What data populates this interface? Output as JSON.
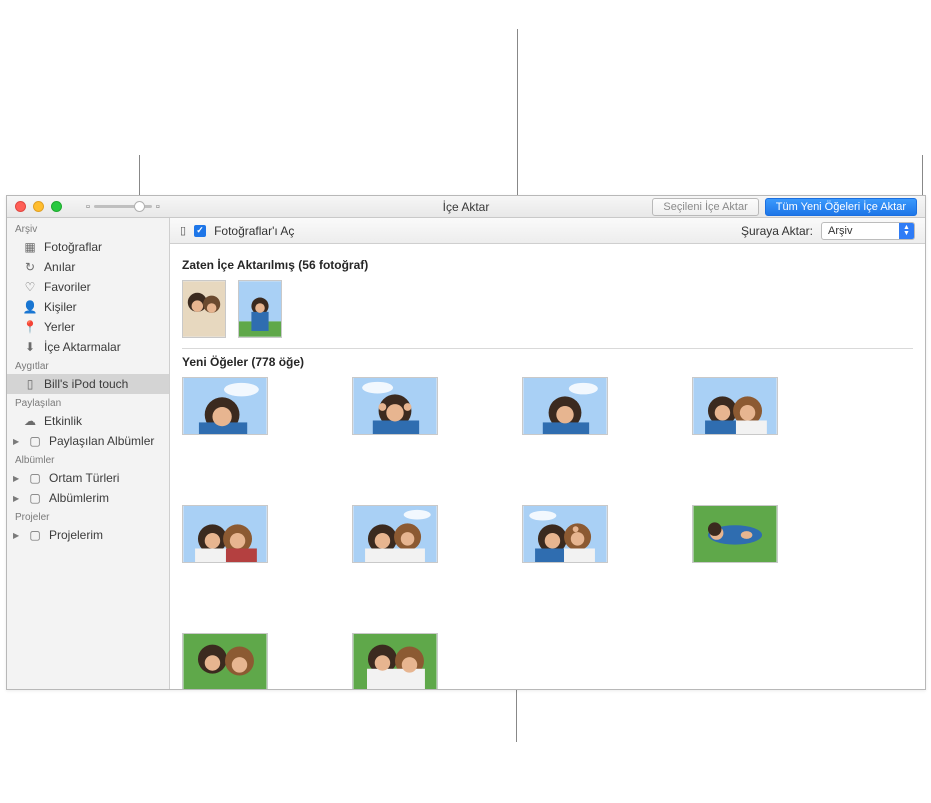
{
  "window": {
    "title": "İçe Aktar"
  },
  "toolbar": {
    "import_selected": "Seçileni İçe Aktar",
    "import_all_new": "Tüm Yeni Öğeleri İçe Aktar"
  },
  "import_bar": {
    "open_photos_label": "Fotoğraflar'ı Aç",
    "import_to_label": "Şuraya Aktar:",
    "import_to_value": "Arşiv"
  },
  "sections": {
    "already_imported": "Zaten İçe Aktarılmış (56 fotoğraf)",
    "new_items": "Yeni Öğeler (778 öğe)"
  },
  "sidebar": {
    "headers": {
      "library": "Arşiv",
      "devices": "Aygıtlar",
      "shared": "Paylaşılan",
      "albums": "Albümler",
      "projects": "Projeler"
    },
    "library": [
      {
        "label": "Fotoğraflar",
        "icon": "photos"
      },
      {
        "label": "Anılar",
        "icon": "clock"
      },
      {
        "label": "Favoriler",
        "icon": "heart"
      },
      {
        "label": "Kişiler",
        "icon": "person"
      },
      {
        "label": "Yerler",
        "icon": "pin"
      },
      {
        "label": "İçe Aktarmalar",
        "icon": "download"
      }
    ],
    "devices": [
      {
        "label": "Bill's iPod touch",
        "icon": "device",
        "selected": true
      }
    ],
    "shared": [
      {
        "label": "Etkinlik",
        "icon": "cloud"
      },
      {
        "label": "Paylaşılan Albümler",
        "icon": "folder",
        "disclosure": true
      }
    ],
    "albums": [
      {
        "label": "Ortam Türleri",
        "icon": "folder",
        "disclosure": true
      },
      {
        "label": "Albümlerim",
        "icon": "folder",
        "disclosure": true
      }
    ],
    "projects": [
      {
        "label": "Projelerim",
        "icon": "folder",
        "disclosure": true
      }
    ]
  }
}
